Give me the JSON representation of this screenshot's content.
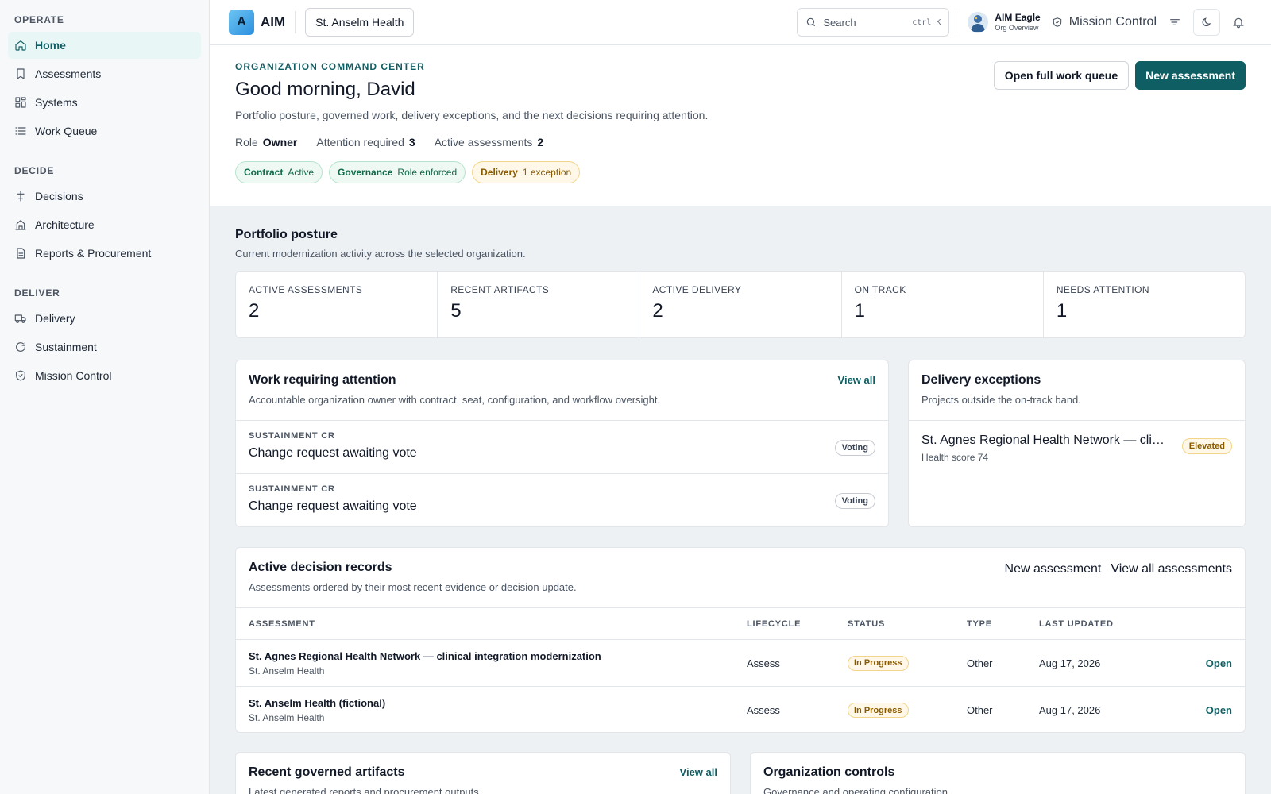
{
  "sidebar": {
    "sections": [
      {
        "label": "OPERATE",
        "items": [
          {
            "label": "Home",
            "icon": "home-icon"
          },
          {
            "label": "Assessments",
            "icon": "bookmark-icon"
          },
          {
            "label": "Systems",
            "icon": "grid-icon"
          },
          {
            "label": "Work Queue",
            "icon": "list-icon"
          }
        ]
      },
      {
        "label": "DECIDE",
        "items": [
          {
            "label": "Decisions",
            "icon": "decision-icon"
          },
          {
            "label": "Architecture",
            "icon": "building-icon"
          },
          {
            "label": "Reports & Procurement",
            "icon": "file-icon"
          }
        ]
      },
      {
        "label": "DELIVER",
        "items": [
          {
            "label": "Delivery",
            "icon": "truck-icon"
          },
          {
            "label": "Sustainment",
            "icon": "refresh-icon"
          },
          {
            "label": "Mission Control",
            "icon": "shield-icon"
          }
        ]
      }
    ],
    "active": "Home"
  },
  "header": {
    "logo_letter": "A",
    "logo_text": "AIM",
    "org": "St. Anselm Health",
    "search_placeholder": "Search",
    "search_shortcut": "ctrl K",
    "user_name": "AIM Eagle",
    "user_sub": "Org Overview",
    "mission_control": "Mission Control"
  },
  "hero": {
    "eyebrow": "ORGANIZATION COMMAND CENTER",
    "greeting": "Good morning, David",
    "description": "Portfolio posture, governed work, delivery exceptions, and the next decisions requiring attention.",
    "meta": {
      "role_label": "Role",
      "role_value": "Owner",
      "attention_label": "Attention required",
      "attention_value": "3",
      "active_label": "Active assessments",
      "active_value": "2"
    },
    "pills": [
      {
        "key": "Contract",
        "value": "Active",
        "tone": "green"
      },
      {
        "key": "Governance",
        "value": "Role enforced",
        "tone": "green"
      },
      {
        "key": "Delivery",
        "value": "1 exception",
        "tone": "amber"
      }
    ],
    "btn_queue": "Open full work queue",
    "btn_new": "New assessment"
  },
  "posture": {
    "title": "Portfolio posture",
    "description": "Current modernization activity across the selected organization.",
    "stats": [
      {
        "label": "ACTIVE ASSESSMENTS",
        "value": "2"
      },
      {
        "label": "RECENT ARTIFACTS",
        "value": "5"
      },
      {
        "label": "ACTIVE DELIVERY",
        "value": "2"
      },
      {
        "label": "ON TRACK",
        "value": "1"
      },
      {
        "label": "NEEDS ATTENTION",
        "value": "1"
      }
    ]
  },
  "work": {
    "title": "Work requiring attention",
    "link": "View all",
    "description": "Accountable organization owner with contract, seat, configuration, and workflow oversight.",
    "rows": [
      {
        "kicker": "SUSTAINMENT CR",
        "title": "Change request awaiting vote",
        "badge": "Voting"
      },
      {
        "kicker": "SUSTAINMENT CR",
        "title": "Change request awaiting vote",
        "badge": "Voting"
      }
    ]
  },
  "exceptions": {
    "title": "Delivery exceptions",
    "description": "Projects outside the on-track band.",
    "rows": [
      {
        "title": "St. Agnes Regional Health Network — clinical integration modernization",
        "sub": "Health score 74",
        "badge": "Elevated"
      }
    ]
  },
  "decisions": {
    "title": "Active decision records",
    "description": "Assessments ordered by their most recent evidence or decision update.",
    "link_new": "New assessment",
    "link_all": "View all assessments",
    "columns": [
      "ASSESSMENT",
      "LIFECYCLE",
      "STATUS",
      "TYPE",
      "LAST UPDATED"
    ],
    "rows": [
      {
        "name": "St. Agnes Regional Health Network — clinical integration modernization",
        "org": "St. Anselm Health",
        "lifecycle": "Assess",
        "status": "In Progress",
        "type": "Other",
        "updated": "Aug 17, 2026",
        "action": "Open"
      },
      {
        "name": "St. Anselm Health (fictional)",
        "org": "St. Anselm Health",
        "lifecycle": "Assess",
        "status": "In Progress",
        "type": "Other",
        "updated": "Aug 17, 2026",
        "action": "Open"
      }
    ]
  },
  "artifacts": {
    "title": "Recent governed artifacts",
    "link": "View all",
    "description": "Latest generated reports and procurement outputs."
  },
  "controls": {
    "title": "Organization controls",
    "description": "Governance and operating configuration."
  },
  "colors": {
    "accent": "#0f5e63",
    "success": "#106a4a",
    "warning": "#8a5a00"
  }
}
